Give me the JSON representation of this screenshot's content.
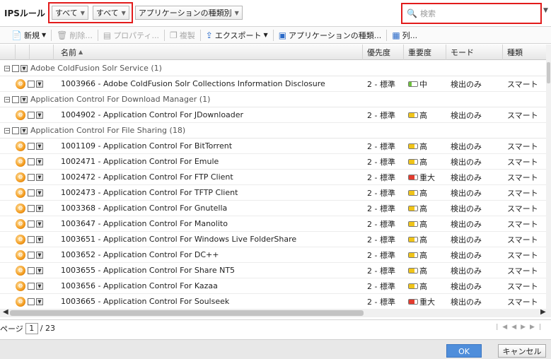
{
  "title": "IPSルール",
  "filters": {
    "all1": "すべて",
    "all2": "すべて",
    "type": "アプリケーションの種類別"
  },
  "search": {
    "placeholder": "検索"
  },
  "toolbar": {
    "new": "新規",
    "delete": "削除...",
    "properties": "プロパティ...",
    "duplicate": "複製",
    "export": "エクスポート",
    "apptype": "アプリケーションの種類...",
    "columns": "列..."
  },
  "columns": {
    "name": "名前",
    "priority": "優先度",
    "severity": "重要度",
    "mode": "モード",
    "type": "種類"
  },
  "groups": [
    {
      "label": "Adobe ColdFusion Solr Service (1)",
      "rows": [
        {
          "name": "1003966 - Adobe ColdFusion Solr Collections Information Disclosure",
          "priority": "2 - 標準",
          "severity": "中",
          "level": 2,
          "mode": "検出のみ",
          "type": "スマート"
        }
      ]
    },
    {
      "label": "Application Control For Download Manager (1)",
      "rows": [
        {
          "name": "1004902 - Application Control For JDownloader",
          "priority": "2 - 標準",
          "severity": "高",
          "level": 3,
          "mode": "検出のみ",
          "type": "スマート"
        }
      ]
    },
    {
      "label": "Application Control For File Sharing (18)",
      "rows": [
        {
          "name": "1001109 - Application Control For BitTorrent",
          "priority": "2 - 標準",
          "severity": "高",
          "level": 3,
          "mode": "検出のみ",
          "type": "スマート"
        },
        {
          "name": "1002471 - Application Control For Emule",
          "priority": "2 - 標準",
          "severity": "高",
          "level": 3,
          "mode": "検出のみ",
          "type": "スマート"
        },
        {
          "name": "1002472 - Application Control For FTP Client",
          "priority": "2 - 標準",
          "severity": "重大",
          "level": 4,
          "mode": "検出のみ",
          "type": "スマート"
        },
        {
          "name": "1002473 - Application Control For TFTP Client",
          "priority": "2 - 標準",
          "severity": "高",
          "level": 3,
          "mode": "検出のみ",
          "type": "スマート"
        },
        {
          "name": "1003368 - Application Control For Gnutella",
          "priority": "2 - 標準",
          "severity": "高",
          "level": 3,
          "mode": "検出のみ",
          "type": "スマート"
        },
        {
          "name": "1003647 - Application Control For Manolito",
          "priority": "2 - 標準",
          "severity": "高",
          "level": 3,
          "mode": "検出のみ",
          "type": "スマート"
        },
        {
          "name": "1003651 - Application Control For Windows Live FolderShare",
          "priority": "2 - 標準",
          "severity": "高",
          "level": 3,
          "mode": "検出のみ",
          "type": "スマート"
        },
        {
          "name": "1003652 - Application Control For DC++",
          "priority": "2 - 標準",
          "severity": "高",
          "level": 3,
          "mode": "検出のみ",
          "type": "スマート"
        },
        {
          "name": "1003655 - Application Control For Share NT5",
          "priority": "2 - 標準",
          "severity": "高",
          "level": 3,
          "mode": "検出のみ",
          "type": "スマート"
        },
        {
          "name": "1003656 - Application Control For Kazaa",
          "priority": "2 - 標準",
          "severity": "高",
          "level": 3,
          "mode": "検出のみ",
          "type": "スマート"
        },
        {
          "name": "1003665 - Application Control For Soulseek",
          "priority": "2 - 標準",
          "severity": "重大",
          "level": 4,
          "mode": "検出のみ",
          "type": "スマート"
        }
      ]
    }
  ],
  "pager": {
    "label": "ページ",
    "current": "1",
    "total": "/ 23"
  },
  "buttons": {
    "ok": "OK",
    "cancel": "キャンセル"
  },
  "colors": {
    "medium": "#6dc13b",
    "high": "#f0c419",
    "critical": "#e23b2e"
  }
}
